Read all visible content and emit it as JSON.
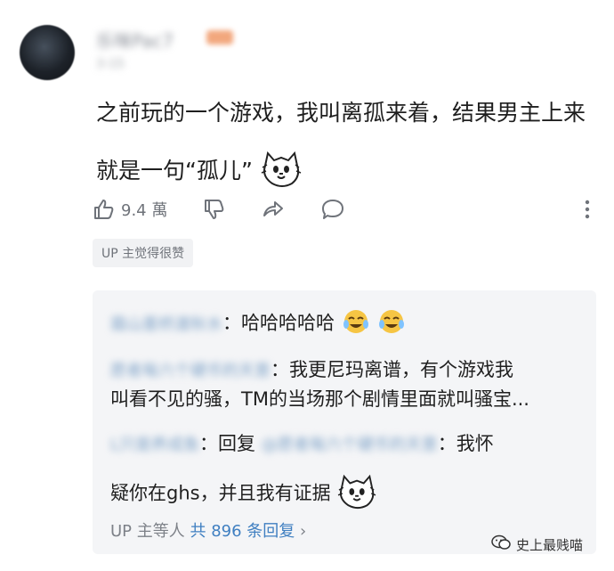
{
  "comment": {
    "username": "乐咪Pac7",
    "level_badge": "LV6",
    "timestamp": "3-15",
    "text_line1": "之前玩的一个游戏，我叫离孤来着，结果男主上来",
    "text_line2": "就是一句“孤儿”",
    "sticker": "cat-face-sticker"
  },
  "actions": {
    "like_count": "9.4 萬",
    "icons": [
      "thumbs-up-icon",
      "thumbs-down-icon",
      "share-icon",
      "comment-icon",
      "more-vertical-icon"
    ]
  },
  "up_tag": "UP 主觉得很赞",
  "replies": {
    "items": [
      {
        "user": "霜山墨桥渡秋水",
        "text": "：哈哈哈哈哈"
      },
      {
        "user": "愿者每六个硬币的天意",
        "text": "：我更尼玛离谱，有个游戏我"
      },
      {
        "user": "",
        "text": "叫看不见的骚，TM的当场那个剧情里面就叫骚宝..."
      },
      {
        "user": "L只是养成鱼",
        "text": "：回复",
        "mention": "@愿者每六个硬币的天意",
        "after": "：我怀"
      },
      {
        "user": "",
        "text": "疑你在ghs，并且我有证据"
      }
    ],
    "footer_prefix": "UP 主等人",
    "footer_count": "共 896 条回复",
    "footer_chevron": "›"
  },
  "watermark": {
    "icon": "wechat-icon",
    "text": "史上最贱喵"
  },
  "colors": {
    "link_blue": "#3f7fc1",
    "reply_bg": "#f4f5f7",
    "gray_text": "#7d8188"
  }
}
